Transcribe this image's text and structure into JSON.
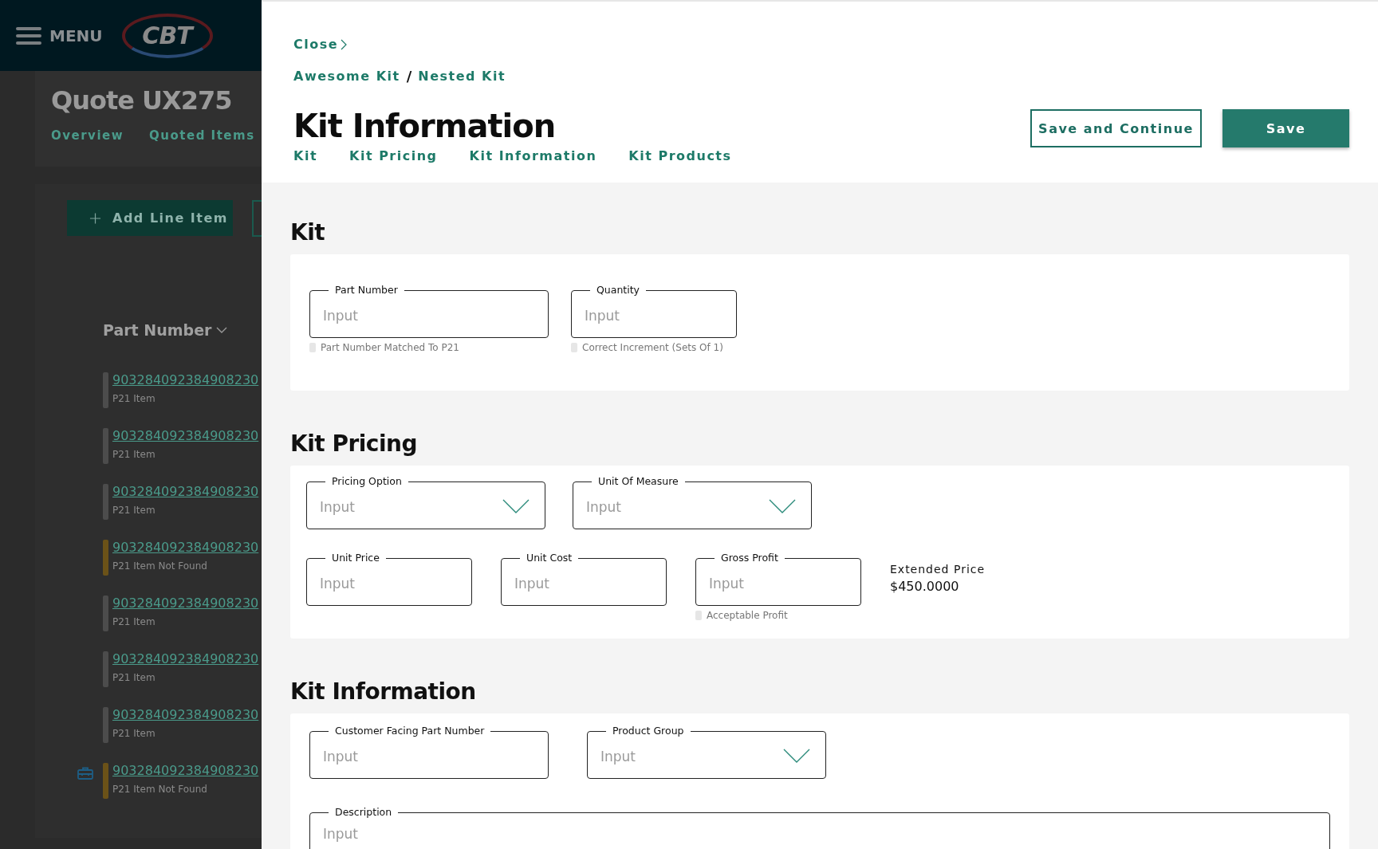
{
  "background_page": {
    "nav": {
      "menu_label": "MENU",
      "logo_text": "CBT"
    },
    "title": "Quote UX275",
    "tabs": [
      {
        "label": "Overview"
      },
      {
        "label": "Quoted Items"
      }
    ],
    "add_button": "Add Line Item",
    "column_header": "Part Number",
    "rows": [
      {
        "part_number": "903284092384908230",
        "status": "P21 Item",
        "color": "#4c4c4c",
        "kit": false
      },
      {
        "part_number": "903284092384908230",
        "status": "P21 Item",
        "color": "#4c4c4c",
        "kit": false
      },
      {
        "part_number": "903284092384908230",
        "status": "P21 Item",
        "color": "#4c4c4c",
        "kit": false
      },
      {
        "part_number": "903284092384908230",
        "status": "P21 Item Not Found",
        "color": "#6b5218",
        "kit": false
      },
      {
        "part_number": "903284092384908230",
        "status": "P21 Item",
        "color": "#4c4c4c",
        "kit": false
      },
      {
        "part_number": "903284092384908230",
        "status": "P21 Item",
        "color": "#4c4c4c",
        "kit": false
      },
      {
        "part_number": "903284092384908230",
        "status": "P21 Item",
        "color": "#4c4c4c",
        "kit": false
      },
      {
        "part_number": "903284092384908230",
        "status": "P21 Item Not Found",
        "color": "#6b5218",
        "kit": true
      }
    ]
  },
  "drawer": {
    "close": "Close",
    "breadcrumb": [
      "Awesome Kit",
      "Nested Kit"
    ],
    "breadcrumb_separator": "/",
    "title": "Kit Information",
    "tabs": [
      {
        "label": "Kit"
      },
      {
        "label": "Kit Pricing"
      },
      {
        "label": "Kit Information"
      },
      {
        "label": "Kit Products"
      }
    ],
    "buttons": [
      {
        "label": "Save and Continue",
        "kind": "outline"
      },
      {
        "label": "Save",
        "kind": "primary"
      }
    ],
    "sections": [
      {
        "title": "Kit",
        "rows": [
          [
            {
              "kind": "text",
              "label": "Part Number",
              "placeholder": "Input",
              "hint": {
                "text": "Part Number Matched To P21",
                "met": false
              }
            },
            {
              "kind": "text",
              "label": "Quantity",
              "placeholder": "Input",
              "hint": {
                "text": "Correct Increment (Sets Of 1)",
                "met": false
              }
            }
          ]
        ]
      },
      {
        "title": "Kit Pricing",
        "rows": [
          [
            {
              "kind": "select",
              "label": "Pricing Option",
              "placeholder": "Input"
            },
            {
              "kind": "select",
              "label": "Unit Of Measure",
              "placeholder": "Input"
            }
          ],
          [
            {
              "kind": "text",
              "label": "Unit Price",
              "placeholder": "Input"
            },
            {
              "kind": "text",
              "label": "Unit Cost",
              "placeholder": "Input"
            },
            {
              "kind": "text",
              "label": "Gross Profit",
              "placeholder": "Input",
              "hint": {
                "text": "Acceptable Profit",
                "met": false
              }
            },
            {
              "kind": "readout",
              "label": "Extended Price",
              "value": "$450.0000"
            }
          ]
        ]
      },
      {
        "title": "Kit Information",
        "rows": [
          [
            {
              "kind": "text",
              "label": "Customer Facing Part Number",
              "placeholder": "Input"
            },
            {
              "kind": "select",
              "label": "Product Group",
              "placeholder": "Input"
            }
          ],
          [
            {
              "kind": "textarea",
              "label": "Description",
              "placeholder": "Input"
            }
          ]
        ]
      }
    ]
  }
}
